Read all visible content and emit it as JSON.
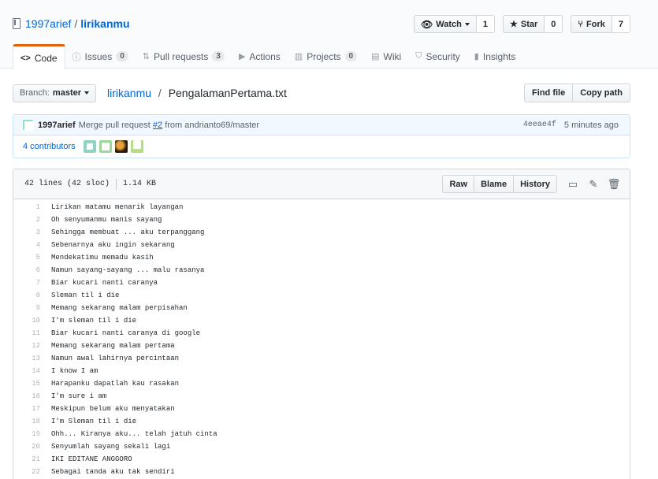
{
  "repo": {
    "owner": "1997arief",
    "name": "lirikanmu"
  },
  "actions": {
    "watch": {
      "label": "Watch",
      "count": "1"
    },
    "star": {
      "label": "Star",
      "count": "0"
    },
    "fork": {
      "label": "Fork",
      "count": "7"
    }
  },
  "tabs": [
    {
      "label": "Code",
      "icon": "code-icon",
      "badge": ""
    },
    {
      "label": "Issues",
      "icon": "issue-icon",
      "badge": "0"
    },
    {
      "label": "Pull requests",
      "icon": "pull-request-icon",
      "badge": "3"
    },
    {
      "label": "Actions",
      "icon": "play-icon",
      "badge": ""
    },
    {
      "label": "Projects",
      "icon": "project-icon",
      "badge": "0"
    },
    {
      "label": "Wiki",
      "icon": "book-icon",
      "badge": ""
    },
    {
      "label": "Security",
      "icon": "shield-icon",
      "badge": ""
    },
    {
      "label": "Insights",
      "icon": "graph-icon",
      "badge": ""
    }
  ],
  "filenav": {
    "branch_prefix": "Branch:",
    "branch": "master",
    "repo_link": "lirikanmu",
    "separator": "/",
    "filename": "PengalamanPertama.txt",
    "find_file": "Find file",
    "copy_path": "Copy path"
  },
  "commit": {
    "author": "1997arief",
    "message_pre": "Merge pull request",
    "pr_link": "#2",
    "message_post": "from andrianto69/master",
    "sha": "4eeae4f",
    "time": "5 minutes ago",
    "contributors": "4 contributors"
  },
  "file": {
    "lines_info": "42 lines (42 sloc)",
    "size": "1.14 KB",
    "raw": "Raw",
    "blame": "Blame",
    "history": "History",
    "lines": [
      "Lirikan matamu menarik layangan",
      "Oh senyumanmu manis sayang",
      "Sehingga membuat ... aku terpanggang",
      "Sebenarnya aku ingin sekarang",
      "Mendekatimu memadu kasih",
      "Namun sayang-sayang ... malu rasanya",
      "Biar kucari nanti caranya",
      "Sleman til i die",
      "Memang sekarang malam perpisahan",
      "I'm sleman til i die",
      "Biar kucari nanti caranya di google",
      "Memang sekarang malam pertama",
      "Namun awal lahirnya percintaan",
      "I know I am",
      "Harapanku dapatlah kau rasakan",
      "I'm sure i am",
      "Meskipun belum aku menyatakan",
      "I'm Sleman til i die",
      "Ohh... Kiranya aku... telah jatuh cinta",
      "Senyumlah sayang sekali lagi",
      "IKI EDITANE ANGGORO",
      "Sebagai tanda aku tak sendiri"
    ]
  },
  "colors": {
    "link": "#0366d6",
    "tab_accent": "#e36209",
    "commit_bg": "#f1f8ff"
  }
}
